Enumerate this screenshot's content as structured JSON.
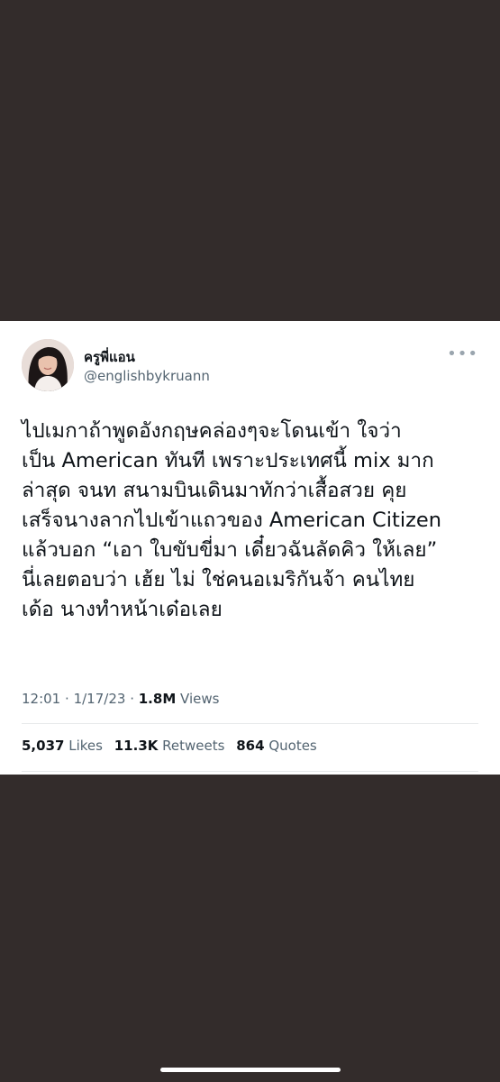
{
  "tweet": {
    "author": {
      "display_name": "ครูพี่แอน",
      "handle": "@englishbykruann"
    },
    "more_icon": "more-horizontal-icon",
    "text_lines": [
      "ไปเมกาถ้าพูดอังกฤษคล่องๆจะโดนเข้า ใจว่า",
      "เป็น American ทันที เพราะประเทศนี้ mix มาก",
      "ล่าสุด จนท สนามบินเดินมาทักว่าเสื้อสวย คุย",
      "เสร็จนางลากไปเข้าแถวของ American Citizen",
      "แล้วบอก “เอา ใบขับขี่มา เดี๋ยวฉันลัดคิว ให้เลย”",
      "นี่เลยตอบว่า เฮ้ย ไม่ ใช่คนอเมริกันจ้า คนไทย",
      "เด้อ นางทำหน้าเด๋อเลย"
    ],
    "meta": {
      "time": "12:01",
      "separator": "·",
      "date": "1/17/23",
      "views_count": "1.8M",
      "views_label": "Views"
    },
    "stats": {
      "likes_count": "5,037",
      "likes_label": "Likes",
      "retweets_count": "11.3K",
      "retweets_label": "Retweets",
      "quotes_count": "864",
      "quotes_label": "Quotes"
    }
  }
}
